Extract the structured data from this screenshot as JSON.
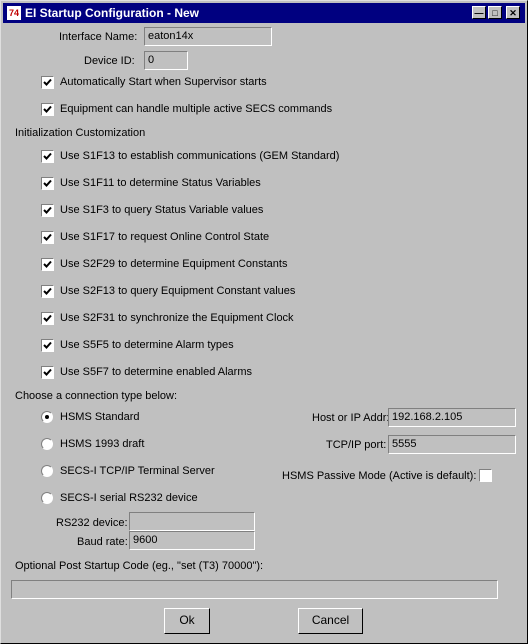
{
  "title": "EI Startup Configuration - New",
  "title_icon": "74",
  "window_controls": {
    "minimize": "minimize-icon",
    "maximize": "maximize-icon",
    "close": "close-icon"
  },
  "interface_name": {
    "label": "Interface Name:",
    "value": "eaton14x"
  },
  "device_id": {
    "label": "Device ID:",
    "value": "0"
  },
  "auto_start": {
    "label": "Automatically Start when Supervisor starts",
    "checked": true
  },
  "multiple_secs": {
    "label": "Equipment can handle multiple active SECS commands",
    "checked": true
  },
  "init_section": "Initialization Customization",
  "init_options": [
    {
      "label": "Use S1F13 to establish communications (GEM Standard)",
      "checked": true
    },
    {
      "label": "Use S1F11 to determine Status Variables",
      "checked": true
    },
    {
      "label": "Use S1F3 to query Status Variable values",
      "checked": true
    },
    {
      "label": "Use S1F17 to request Online Control State",
      "checked": true
    },
    {
      "label": "Use S2F29 to determine Equipment Constants",
      "checked": true
    },
    {
      "label": "Use S2F13 to query Equipment Constant values",
      "checked": true
    },
    {
      "label": "Use S2F31 to synchronize the Equipment Clock",
      "checked": true
    },
    {
      "label": "Use S5F5 to determine Alarm types",
      "checked": true
    },
    {
      "label": "Use S5F7 to determine enabled Alarms",
      "checked": true
    }
  ],
  "connection_section": "Choose a connection type below:",
  "connection_types": [
    {
      "label": "HSMS Standard",
      "selected": true
    },
    {
      "label": "HSMS 1993 draft",
      "selected": false
    },
    {
      "label": "SECS-I TCP/IP Terminal Server",
      "selected": false
    },
    {
      "label": "SECS-I serial RS232 device",
      "selected": false
    }
  ],
  "host": {
    "label": "Host or IP Addr:",
    "value": "192.168.2.105"
  },
  "port": {
    "label": "TCP/IP port:",
    "value": "5555"
  },
  "passive": {
    "label": "HSMS Passive Mode (Active is default):",
    "checked": false
  },
  "rs232": {
    "label": "RS232 device:",
    "value": ""
  },
  "baud": {
    "label": "Baud rate:",
    "value": "9600"
  },
  "post_startup": {
    "label": "Optional Post Startup Code (eg., \"set (T3) 70000\"):",
    "value": ""
  },
  "buttons": {
    "ok": "Ok",
    "cancel": "Cancel"
  },
  "colors": {
    "titlebar": "#000080",
    "face": "#c0c0c0"
  }
}
